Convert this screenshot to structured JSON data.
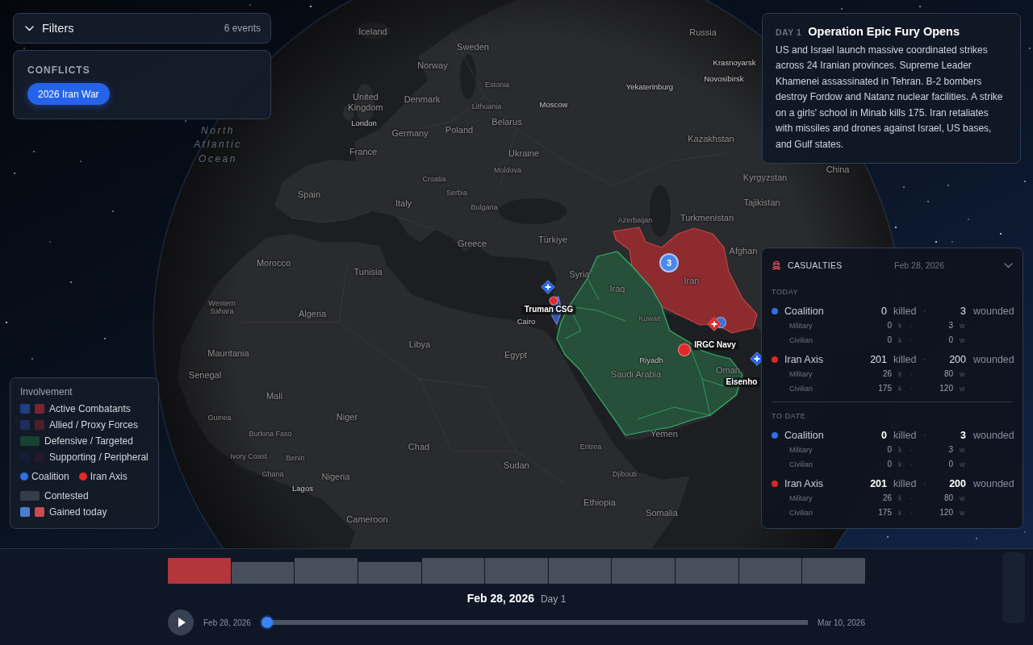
{
  "filters": {
    "label": "Filters",
    "count": "6 events",
    "expanded": true
  },
  "conflicts": {
    "heading": "CONFLICTS",
    "items": [
      {
        "label": "2026 Iran War",
        "selected": true
      }
    ]
  },
  "event": {
    "day": "DAY 1",
    "title": "Operation Epic Fury Opens",
    "body": "US and Israel launch massive coordinated strikes across 24 Iranian provinces. Supreme Leader Khamenei assassinated in Tehran. B-2 bombers destroy Fordow and Natanz nuclear facilities. A strike on a girls' school in Minab kills 175. Iran retaliates with missiles and drones against Israel, US bases, and Gulf states."
  },
  "map": {
    "regions": [
      {
        "kind": "active",
        "color": "#8e2b2f"
      },
      {
        "kind": "defensive",
        "color": "#27503a"
      },
      {
        "kind": "allied",
        "color": "#3556a8"
      }
    ],
    "labels": [
      {
        "text": "Iceland",
        "kind": "country"
      },
      {
        "text": "Russia",
        "kind": "country"
      },
      {
        "text": "Sweden",
        "kind": "country"
      },
      {
        "text": "Norway",
        "kind": "country"
      },
      {
        "text": "Krasnoyarsk",
        "kind": "city"
      },
      {
        "text": "Novosibirsk",
        "kind": "city"
      },
      {
        "text": "Estonia",
        "kind": "minor"
      },
      {
        "text": "Yekaterinburg",
        "kind": "city"
      },
      {
        "text": "United Kingdom",
        "kind": "country"
      },
      {
        "text": "Denmark",
        "kind": "country"
      },
      {
        "text": "Lithuania",
        "kind": "minor"
      },
      {
        "text": "Moscow",
        "kind": "city"
      },
      {
        "text": "North Atlantic Ocean",
        "kind": "ocean"
      },
      {
        "text": "London",
        "kind": "city"
      },
      {
        "text": "Belarus",
        "kind": "country"
      },
      {
        "text": "Germany",
        "kind": "country"
      },
      {
        "text": "Poland",
        "kind": "country"
      },
      {
        "text": "Kazakhstan",
        "kind": "country"
      },
      {
        "text": "France",
        "kind": "country"
      },
      {
        "text": "Ukraine",
        "kind": "country"
      },
      {
        "text": "Moldova",
        "kind": "minor"
      },
      {
        "text": "China",
        "kind": "country"
      },
      {
        "text": "Croatia",
        "kind": "minor"
      },
      {
        "text": "Kyrgyzstan",
        "kind": "country"
      },
      {
        "text": "Spain",
        "kind": "country"
      },
      {
        "text": "Serbia",
        "kind": "minor"
      },
      {
        "text": "Italy",
        "kind": "country"
      },
      {
        "text": "Bulgaria",
        "kind": "minor"
      },
      {
        "text": "Tajikistan",
        "kind": "country"
      },
      {
        "text": "Azerbaijan",
        "kind": "minor"
      },
      {
        "text": "Turkmenistan",
        "kind": "country"
      },
      {
        "text": "Greece",
        "kind": "country"
      },
      {
        "text": "Türkiye",
        "kind": "country"
      },
      {
        "text": "Afghan",
        "kind": "country"
      },
      {
        "text": "Morocco",
        "kind": "country"
      },
      {
        "text": "Tunisia",
        "kind": "country"
      },
      {
        "text": "Syria",
        "kind": "country"
      },
      {
        "text": "Iran",
        "kind": "country"
      },
      {
        "text": "Iraq",
        "kind": "country"
      },
      {
        "text": "Western Sahara",
        "kind": "minor"
      },
      {
        "text": "Algeria",
        "kind": "country"
      },
      {
        "text": "Truman CSG",
        "kind": "unit"
      },
      {
        "text": "Cairo",
        "kind": "city"
      },
      {
        "text": "Kuwait",
        "kind": "minor"
      },
      {
        "text": "Libya",
        "kind": "country"
      },
      {
        "text": "IRGC Navy",
        "kind": "unit"
      },
      {
        "text": "Mauritania",
        "kind": "country"
      },
      {
        "text": "Egypt",
        "kind": "country"
      },
      {
        "text": "Riyadh",
        "kind": "city"
      },
      {
        "text": "Senegal",
        "kind": "country"
      },
      {
        "text": "Saudi Arabia",
        "kind": "country"
      },
      {
        "text": "Oman",
        "kind": "country"
      },
      {
        "text": "Eisenho",
        "kind": "unit"
      },
      {
        "text": "Mali",
        "kind": "country"
      },
      {
        "text": "Guinea",
        "kind": "minor"
      },
      {
        "text": "Niger",
        "kind": "country"
      },
      {
        "text": "Burkina Faso",
        "kind": "minor"
      },
      {
        "text": "Yemen",
        "kind": "country"
      },
      {
        "text": "Chad",
        "kind": "country"
      },
      {
        "text": "Eritrea",
        "kind": "minor"
      },
      {
        "text": "Ivory Coast",
        "kind": "minor"
      },
      {
        "text": "Benin",
        "kind": "minor"
      },
      {
        "text": "Sudan",
        "kind": "country"
      },
      {
        "text": "Ghana",
        "kind": "minor"
      },
      {
        "text": "Nigeria",
        "kind": "country"
      },
      {
        "text": "Djibouti",
        "kind": "minor"
      },
      {
        "text": "Lagos",
        "kind": "city"
      },
      {
        "text": "Ethiopia",
        "kind": "country"
      },
      {
        "text": "Somalia",
        "kind": "country"
      },
      {
        "text": "Cameroon",
        "kind": "country"
      }
    ],
    "markers": [
      {
        "kind": "cluster",
        "label": "3",
        "color": "#4a88ee"
      },
      {
        "kind": "strike",
        "color": "#2563eb"
      },
      {
        "kind": "dot",
        "color": "#e0282d"
      },
      {
        "kind": "dot",
        "color": "#e0282d"
      },
      {
        "kind": "dot",
        "color": "#3d6fd6"
      },
      {
        "kind": "strike",
        "color": "#e0282d"
      },
      {
        "kind": "strike",
        "color": "#2563eb"
      }
    ]
  },
  "legend": {
    "title": "Involvement",
    "items": [
      {
        "kind": "pair",
        "label": "Active Combatants",
        "swatches": [
          {
            "color": "#1f3f80"
          },
          {
            "color": "#7a2430"
          }
        ]
      },
      {
        "kind": "pair",
        "label": "Allied / Proxy Forces",
        "swatches": [
          {
            "color": "#1c2f5e"
          },
          {
            "color": "#4c1f2a"
          }
        ]
      },
      {
        "kind": "wide",
        "label": "Defensive / Targeted",
        "color": "#17422f"
      },
      {
        "kind": "pair",
        "label": "Supporting / Peripheral",
        "swatches": [
          {
            "color": "#141d37"
          },
          {
            "color": "#25182a"
          }
        ]
      },
      {
        "kind": "dots",
        "entries": [
          {
            "label": "Coalition",
            "color": "#2f6fe8"
          },
          {
            "label": "Iran Axis",
            "color": "#e02a2a"
          }
        ]
      },
      {
        "kind": "wide",
        "label": "Contested",
        "color": "#363c48"
      },
      {
        "kind": "pair",
        "label": "Gained today",
        "swatches": [
          {
            "color": "#4d7bd1"
          },
          {
            "color": "#cc4a50"
          }
        ]
      }
    ]
  },
  "casualties": {
    "title": "CASUALTIES",
    "date": "Feb 28, 2026",
    "sections": [
      {
        "label": "TODAY",
        "totals_bold": false,
        "sides": [
          {
            "name": "Coalition",
            "color": "#2f6fe8",
            "killed": "0",
            "killed_label": "killed",
            "separator": "·",
            "wounded": "3",
            "wounded_label": "wounded",
            "breakdown": [
              {
                "name": "Military",
                "killed": "0",
                "killed_label": "k",
                "separator": "·",
                "wounded": "3",
                "wounded_label": "w"
              },
              {
                "name": "Civilian",
                "killed": "0",
                "killed_label": "k",
                "separator": "·",
                "wounded": "0",
                "wounded_label": "w"
              }
            ]
          },
          {
            "name": "Iran Axis",
            "color": "#dc2626",
            "killed": "201",
            "killed_label": "killed",
            "separator": "·",
            "wounded": "200",
            "wounded_label": "wounded",
            "breakdown": [
              {
                "name": "Military",
                "killed": "26",
                "killed_label": "k",
                "separator": "·",
                "wounded": "80",
                "wounded_label": "w"
              },
              {
                "name": "Civilian",
                "killed": "175",
                "killed_label": "k",
                "separator": "·",
                "wounded": "120",
                "wounded_label": "w"
              }
            ]
          }
        ]
      },
      {
        "label": "TO DATE",
        "totals_bold": true,
        "sides": [
          {
            "name": "Coalition",
            "color": "#2f6fe8",
            "killed": "0",
            "killed_label": "killed",
            "separator": "·",
            "wounded": "3",
            "wounded_label": "wounded",
            "breakdown": [
              {
                "name": "Military",
                "killed": "0",
                "killed_label": "k",
                "separator": "·",
                "wounded": "3",
                "wounded_label": "w"
              },
              {
                "name": "Civilian",
                "killed": "0",
                "killed_label": "k",
                "separator": "·",
                "wounded": "0",
                "wounded_label": "w"
              }
            ]
          },
          {
            "name": "Iran Axis",
            "color": "#dc2626",
            "killed": "201",
            "killed_label": "killed",
            "separator": "·",
            "wounded": "200",
            "wounded_label": "wounded",
            "breakdown": [
              {
                "name": "Military",
                "killed": "26",
                "killed_label": "k",
                "separator": "·",
                "wounded": "80",
                "wounded_label": "w"
              },
              {
                "name": "Civilian",
                "killed": "175",
                "killed_label": "k",
                "separator": "·",
                "wounded": "120",
                "wounded_label": "w"
              }
            ]
          }
        ]
      }
    ]
  },
  "timeline": {
    "days": [
      {
        "selected": true
      },
      {
        "selected": false
      },
      {
        "selected": false
      },
      {
        "selected": false
      },
      {
        "selected": false
      },
      {
        "selected": false
      },
      {
        "selected": false
      },
      {
        "selected": false
      },
      {
        "selected": false
      },
      {
        "selected": false
      },
      {
        "selected": false
      }
    ],
    "date": "Feb 28, 2026",
    "day": "Day 1",
    "playing": false,
    "start": "Feb 28, 2026",
    "level": 0,
    "end": "Mar 10, 2026"
  }
}
